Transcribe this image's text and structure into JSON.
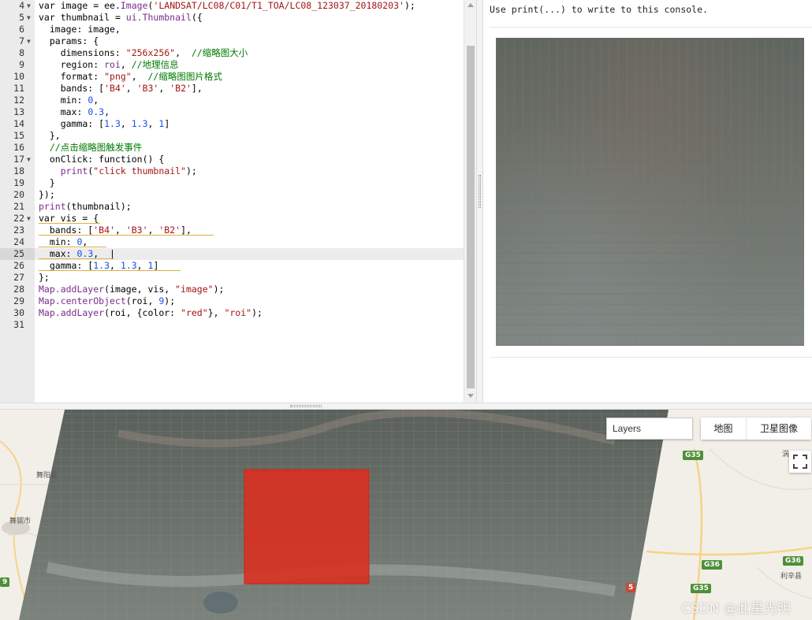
{
  "editor": {
    "active_line": "25",
    "lines": [
      {
        "n": "4",
        "fold": true,
        "tokens": [
          [
            "kw",
            "var "
          ],
          [
            "pl",
            "image = ee."
          ],
          [
            "fn",
            "Image"
          ],
          [
            "pl",
            "("
          ],
          [
            "str",
            "'LANDSAT/LC08/C01/T1_TOA/LC08_123037_20180203'"
          ],
          [
            "pl",
            ");"
          ]
        ]
      },
      {
        "n": "5",
        "fold": true,
        "tokens": [
          [
            "kw",
            "var "
          ],
          [
            "pl",
            "thumbnail = "
          ],
          [
            "fn",
            "ui.Thumbnail"
          ],
          [
            "pl",
            "({"
          ]
        ]
      },
      {
        "n": "6",
        "fold": false,
        "tokens": [
          [
            "pl",
            "  image: image,"
          ]
        ]
      },
      {
        "n": "7",
        "fold": true,
        "tokens": [
          [
            "pl",
            "  params: {"
          ]
        ]
      },
      {
        "n": "8",
        "fold": false,
        "tokens": [
          [
            "pl",
            "    dimensions: "
          ],
          [
            "str",
            "\"256x256\""
          ],
          [
            "pl",
            ",  "
          ],
          [
            "cm",
            "//缩略图大小"
          ]
        ]
      },
      {
        "n": "9",
        "fold": false,
        "tokens": [
          [
            "pl",
            "    region: "
          ],
          [
            "fn",
            "roi"
          ],
          [
            "pl",
            ", "
          ],
          [
            "cm",
            "//地理信息"
          ]
        ]
      },
      {
        "n": "10",
        "fold": false,
        "tokens": [
          [
            "pl",
            "    format: "
          ],
          [
            "str",
            "\"png\""
          ],
          [
            "pl",
            ",  "
          ],
          [
            "cm",
            "//缩略图图片格式"
          ]
        ]
      },
      {
        "n": "11",
        "fold": false,
        "tokens": [
          [
            "pl",
            "    bands: ["
          ],
          [
            "str",
            "'B4'"
          ],
          [
            "pl",
            ", "
          ],
          [
            "str",
            "'B3'"
          ],
          [
            "pl",
            ", "
          ],
          [
            "str",
            "'B2'"
          ],
          [
            "pl",
            "],"
          ]
        ]
      },
      {
        "n": "12",
        "fold": false,
        "tokens": [
          [
            "pl",
            "    min: "
          ],
          [
            "num",
            "0"
          ],
          [
            "pl",
            ","
          ]
        ]
      },
      {
        "n": "13",
        "fold": false,
        "tokens": [
          [
            "pl",
            "    max: "
          ],
          [
            "num",
            "0.3"
          ],
          [
            "pl",
            ","
          ]
        ]
      },
      {
        "n": "14",
        "fold": false,
        "tokens": [
          [
            "pl",
            "    gamma: ["
          ],
          [
            "num",
            "1.3"
          ],
          [
            "pl",
            ", "
          ],
          [
            "num",
            "1.3"
          ],
          [
            "pl",
            ", "
          ],
          [
            "num",
            "1"
          ],
          [
            "pl",
            "]"
          ]
        ]
      },
      {
        "n": "15",
        "fold": false,
        "tokens": [
          [
            "pl",
            "  },"
          ]
        ]
      },
      {
        "n": "16",
        "fold": false,
        "tokens": [
          [
            "pl",
            "  "
          ],
          [
            "cm",
            "//点击缩略图触发事件"
          ]
        ]
      },
      {
        "n": "17",
        "fold": true,
        "tokens": [
          [
            "pl",
            "  onClick: "
          ],
          [
            "kw",
            "function"
          ],
          [
            "pl",
            "() {"
          ]
        ]
      },
      {
        "n": "18",
        "fold": false,
        "tokens": [
          [
            "pl",
            "    "
          ],
          [
            "fn",
            "print"
          ],
          [
            "pl",
            "("
          ],
          [
            "str",
            "\"click thumbnail\""
          ],
          [
            "pl",
            ");"
          ]
        ]
      },
      {
        "n": "19",
        "fold": false,
        "tokens": [
          [
            "pl",
            "  }"
          ]
        ]
      },
      {
        "n": "20",
        "fold": false,
        "tokens": [
          [
            "pl",
            "});"
          ]
        ]
      },
      {
        "n": "21",
        "fold": false,
        "tokens": [
          [
            "fn",
            "print"
          ],
          [
            "pl",
            "(thumbnail);"
          ]
        ]
      },
      {
        "n": "22",
        "fold": true,
        "tokens": [
          [
            "kw",
            "var "
          ],
          [
            "pl",
            "vis = {"
          ]
        ]
      },
      {
        "n": "23",
        "fold": false,
        "tokens": [
          [
            "pl",
            "  bands: ["
          ],
          [
            "str",
            "'B4'"
          ],
          [
            "pl",
            ", "
          ],
          [
            "str",
            "'B3'"
          ],
          [
            "pl",
            ", "
          ],
          [
            "str",
            "'B2'"
          ],
          [
            "pl",
            "],"
          ]
        ]
      },
      {
        "n": "24",
        "fold": false,
        "tokens": [
          [
            "pl",
            "  min: "
          ],
          [
            "num",
            "0"
          ],
          [
            "pl",
            ","
          ]
        ]
      },
      {
        "n": "25",
        "fold": false,
        "tokens": [
          [
            "pl",
            "  max: "
          ],
          [
            "num",
            "0.3"
          ],
          [
            "pl",
            ",  |"
          ]
        ]
      },
      {
        "n": "26",
        "fold": false,
        "tokens": [
          [
            "pl",
            "  gamma: ["
          ],
          [
            "num",
            "1.3"
          ],
          [
            "pl",
            ", "
          ],
          [
            "num",
            "1.3"
          ],
          [
            "pl",
            ", "
          ],
          [
            "num",
            "1"
          ],
          [
            "pl",
            "]"
          ]
        ]
      },
      {
        "n": "27",
        "fold": false,
        "tokens": [
          [
            "pl",
            "};"
          ]
        ]
      },
      {
        "n": "28",
        "fold": false,
        "tokens": [
          [
            "fn",
            "Map.addLayer"
          ],
          [
            "pl",
            "(image, vis, "
          ],
          [
            "str",
            "\"image\""
          ],
          [
            "pl",
            ");"
          ]
        ]
      },
      {
        "n": "29",
        "fold": false,
        "tokens": [
          [
            "fn",
            "Map.centerObject"
          ],
          [
            "pl",
            "(roi, "
          ],
          [
            "num",
            "9"
          ],
          [
            "pl",
            ");"
          ]
        ]
      },
      {
        "n": "30",
        "fold": false,
        "tokens": [
          [
            "fn",
            "Map.addLayer"
          ],
          [
            "pl",
            "(roi, {color: "
          ],
          [
            "str",
            "\"red\""
          ],
          [
            "pl",
            "}, "
          ],
          [
            "str",
            "\"roi\""
          ],
          [
            "pl",
            ");"
          ]
        ]
      },
      {
        "n": "31",
        "fold": false,
        "tokens": []
      }
    ]
  },
  "console": {
    "hint": "Use print(...) to write to this console."
  },
  "map": {
    "layers_label": "Layers",
    "map_type_map": "地图",
    "map_type_satellite": "卫星图像",
    "roads": [
      "G35",
      "G36",
      "G36",
      "G35",
      "5",
      "9"
    ],
    "places": [
      "舞阳县",
      "舞钢市",
      "利辛县",
      "涡"
    ],
    "roi_color": "#d93020"
  },
  "watermark": "CSDN @此星光明"
}
